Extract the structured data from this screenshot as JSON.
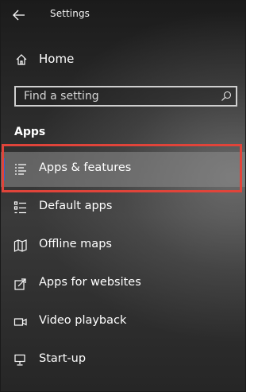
{
  "window": {
    "title": "Settings",
    "back_icon": "arrow-left-icon"
  },
  "home": {
    "label": "Home",
    "icon": "home-icon"
  },
  "search": {
    "placeholder": "Find a setting",
    "value": "",
    "icon": "search-icon"
  },
  "section": {
    "title": "Apps"
  },
  "nav": {
    "items": [
      {
        "label": "Apps & features",
        "icon": "list-icon",
        "selected": true
      },
      {
        "label": "Default apps",
        "icon": "default-apps-icon",
        "selected": false
      },
      {
        "label": "Offline maps",
        "icon": "map-icon",
        "selected": false
      },
      {
        "label": "Apps for websites",
        "icon": "website-link-icon",
        "selected": false
      },
      {
        "label": "Video playback",
        "icon": "video-icon",
        "selected": false
      },
      {
        "label": "Start-up",
        "icon": "monitor-icon",
        "selected": false
      }
    ]
  },
  "colors": {
    "accent": "#3a63c9",
    "highlight_border": "#e0443a",
    "text": "#ffffff"
  }
}
